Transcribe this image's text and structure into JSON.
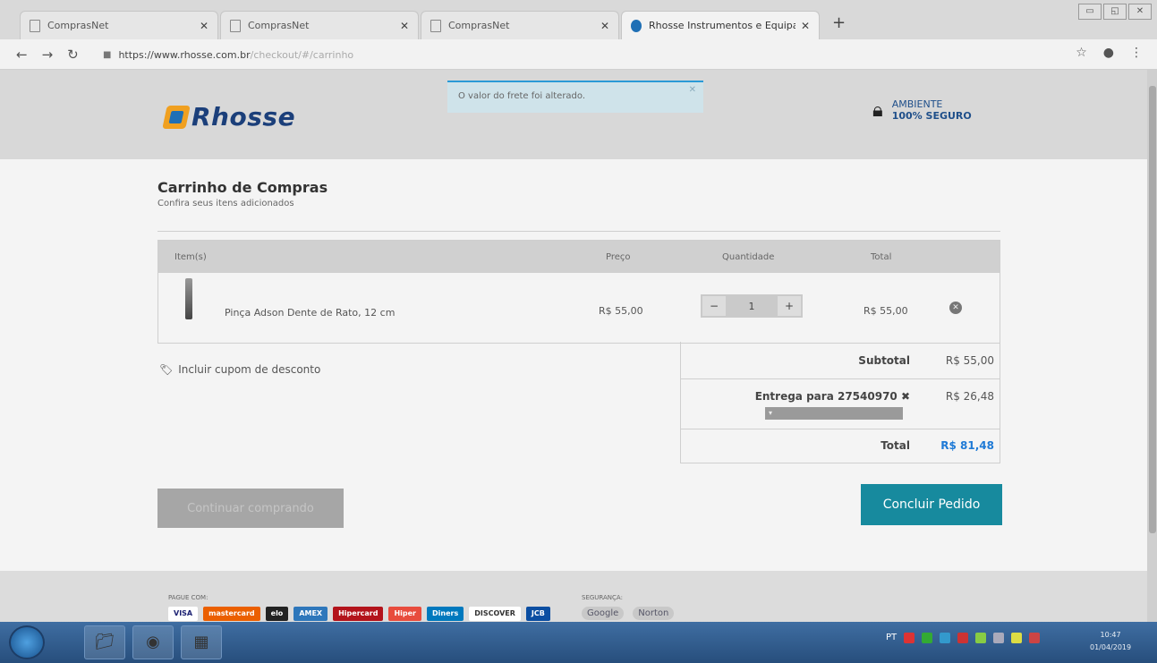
{
  "browser": {
    "tabs": [
      {
        "title": "ComprasNet",
        "active": false
      },
      {
        "title": "ComprasNet",
        "active": false
      },
      {
        "title": "ComprasNet",
        "active": false
      },
      {
        "title": "Rhosse Instrumentos e Equipame",
        "active": true
      }
    ],
    "new_tab": "+",
    "url_host": "https://www.rhosse.com.br",
    "url_path": "/checkout/#/carrinho"
  },
  "header": {
    "logo_text": "Rhosse",
    "toast_message": "O valor do frete foi alterado.",
    "secure_line1": "AMBIENTE",
    "secure_line2": "100% SEGURO"
  },
  "cart": {
    "title": "Carrinho de Compras",
    "subtitle": "Confira seus itens adicionados",
    "columns": {
      "item": "Item(s)",
      "price": "Preço",
      "quantity": "Quantidade",
      "total": "Total"
    },
    "items": [
      {
        "name": "Pinça Adson Dente de Rato, 12 cm",
        "price": "R$ 55,00",
        "quantity": "1",
        "total": "R$ 55,00"
      }
    ],
    "coupon_label": "Incluir cupom de desconto"
  },
  "summary": {
    "subtotal_label": "Subtotal",
    "subtotal_value": "R$ 55,00",
    "shipping_label": "Entrega para 27540970 ✖",
    "shipping_value": "R$ 26,48",
    "total_label": "Total",
    "total_value": "R$ 81,48"
  },
  "buttons": {
    "continue": "Continuar comprando",
    "checkout": "Concluir Pedido"
  },
  "footer": {
    "pay_label": "PAGUE COM:",
    "payment_brands": [
      "VISA",
      "mastercard",
      "elo",
      "AMEX",
      "Hipercard",
      "Hiper",
      "Diners",
      "DISCOVER",
      "JCB"
    ],
    "security_label": "SEGURANÇA:",
    "security_brands": [
      "Google",
      "Norton"
    ]
  },
  "taskbar": {
    "tray_lang": "PT",
    "time": "10:47",
    "date": "01/04/2019"
  },
  "colors": {
    "accent": "#178a9e",
    "link": "#1f7ad6",
    "brand_navy": "#1b3f7a",
    "brand_orange": "#f0a020"
  }
}
